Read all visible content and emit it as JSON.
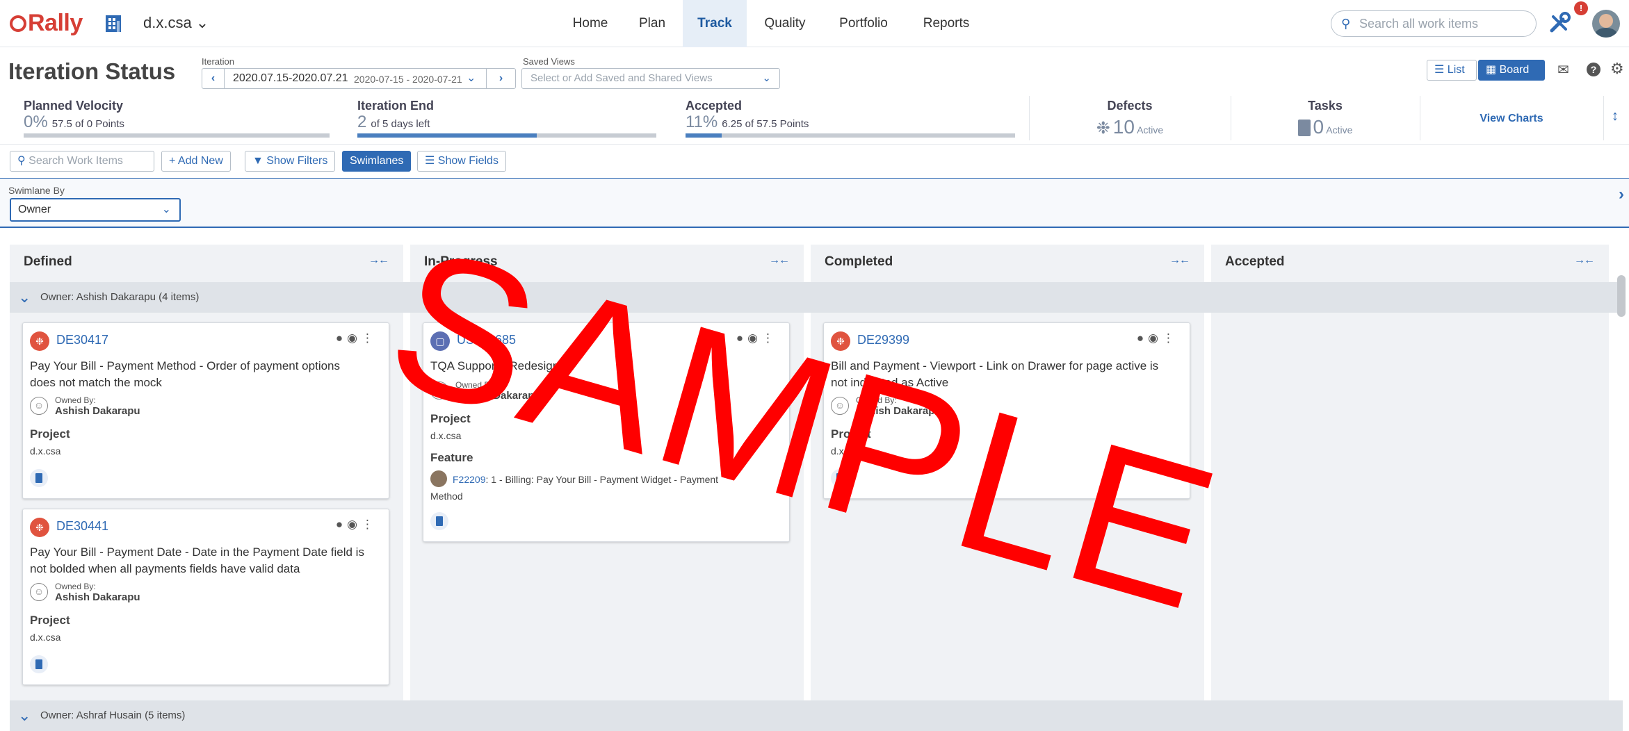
{
  "app": {
    "logo": "Rally",
    "workspace": "d.x.csa ⌄"
  },
  "nav": {
    "items": [
      "Home",
      "Plan",
      "Track",
      "Quality",
      "Portfolio",
      "Reports"
    ],
    "active": "Track"
  },
  "search": {
    "placeholder": "Search all work items"
  },
  "notification_count": "!",
  "header": {
    "title": "Iteration Status",
    "iteration_label": "Iteration",
    "iteration_name": "2020.07.15-2020.07.21",
    "iteration_dates": "2020-07-15 - 2020-07-21",
    "saved_views_label": "Saved Views",
    "saved_views_placeholder": "Select or Add Saved and Shared Views",
    "list_label": "List",
    "board_label": "Board"
  },
  "metrics": {
    "velocity": {
      "title": "Planned Velocity",
      "value": "0%",
      "detail": "57.5 of 0 Points",
      "progress": 0
    },
    "iteration_end": {
      "title": "Iteration End",
      "value": "2",
      "detail": "of 5 days left",
      "progress": 0.6
    },
    "accepted": {
      "title": "Accepted",
      "value": "11%",
      "detail": "6.25 of 57.5 Points",
      "progress": 0.11
    },
    "defects": {
      "title": "Defects",
      "value": "10",
      "detail": "Active"
    },
    "tasks": {
      "title": "Tasks",
      "value": "0",
      "detail": "Active"
    },
    "view_charts": "View Charts"
  },
  "toolbar": {
    "search_placeholder": "Search Work Items",
    "add_new": "+ Add New",
    "show_filters": "Show Filters",
    "swimlanes": "Swimlanes",
    "show_fields": "Show Fields"
  },
  "swimlane": {
    "label": "Swimlane By",
    "value": "Owner"
  },
  "columns": [
    "Defined",
    "In-Progress",
    "Completed",
    "Accepted"
  ],
  "lanes": [
    "Owner: Ashish Dakarapu  (4 items)",
    "Owner: Ashraf Husain  (5 items)"
  ],
  "cards": [
    {
      "id": "DE30417",
      "name1": "Pay Your Bill - Payment Method - Order of payment options",
      "name2": "does not match the mock",
      "owned_by": "Owned By:",
      "owner": "Ashish Dakarapu",
      "project_label": "Project",
      "project": "d.x.csa"
    },
    {
      "id": "DE30441",
      "name1": "Pay Your Bill - Payment Date - Date in the Payment Date field is",
      "name2": "not bolded when all payments fields have valid data",
      "owned_by": "Owned By:",
      "owner": "Ashish Dakarapu",
      "project_label": "Project",
      "project": "d.x.csa"
    },
    {
      "id": "US161685",
      "name1": "TQA Support - Redesign",
      "owned_by": "Owned By:",
      "owner": "Ashish Dakarapu",
      "project_label": "Project",
      "project": "d.x.csa",
      "feature_label": "Feature",
      "feature_id": "F22209",
      "feature_name1": ": 1 - Billing: Pay Your Bill - Payment Widget - Payment",
      "feature_name2": "Method"
    },
    {
      "id": "DE29399",
      "name1": "Bill and Payment - Viewport - Link on Drawer for page active is",
      "name2": "not indicated as Active",
      "owned_by": "Owned By:",
      "owner": "Ashish Dakarapu",
      "project_label": "Project",
      "project": "d.x.csa"
    }
  ],
  "watermark": "SAMPLE"
}
